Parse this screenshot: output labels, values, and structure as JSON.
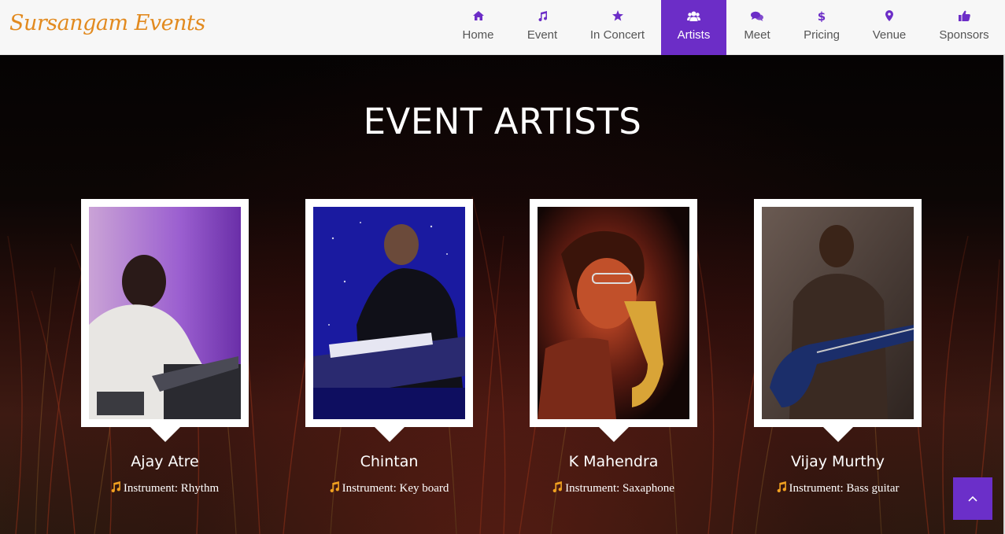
{
  "brand": {
    "logo_text": "Sursangam Events"
  },
  "nav": {
    "items": [
      {
        "label": "Home",
        "icon": "home-icon"
      },
      {
        "label": "Event",
        "icon": "music-note-icon"
      },
      {
        "label": "In Concert",
        "icon": "star-icon"
      },
      {
        "label": "Artists",
        "icon": "users-icon",
        "active": true
      },
      {
        "label": "Meet",
        "icon": "chat-bubbles-icon"
      },
      {
        "label": "Pricing",
        "icon": "dollar-icon"
      },
      {
        "label": "Venue",
        "icon": "map-marker-icon"
      },
      {
        "label": "Sponsors",
        "icon": "thumbs-up-icon"
      }
    ]
  },
  "section": {
    "title": "EVENT ARTISTS"
  },
  "artists": [
    {
      "name": "Ajay Atre",
      "instrument": "Instrument: Rhythm"
    },
    {
      "name": "Chintan",
      "instrument": "Instrument: Key board"
    },
    {
      "name": "K Mahendra",
      "instrument": "Instrument: Saxaphone"
    },
    {
      "name": "Vijay Murthy",
      "instrument": "Instrument: Bass guitar"
    }
  ],
  "colors": {
    "accent": "#6c2dc7",
    "brand": "#e28a1f",
    "nav_icon": "#6c2dc7",
    "instrument_icon": "#f0a020"
  },
  "back_to_top": {
    "icon": "chevron-up-icon"
  }
}
